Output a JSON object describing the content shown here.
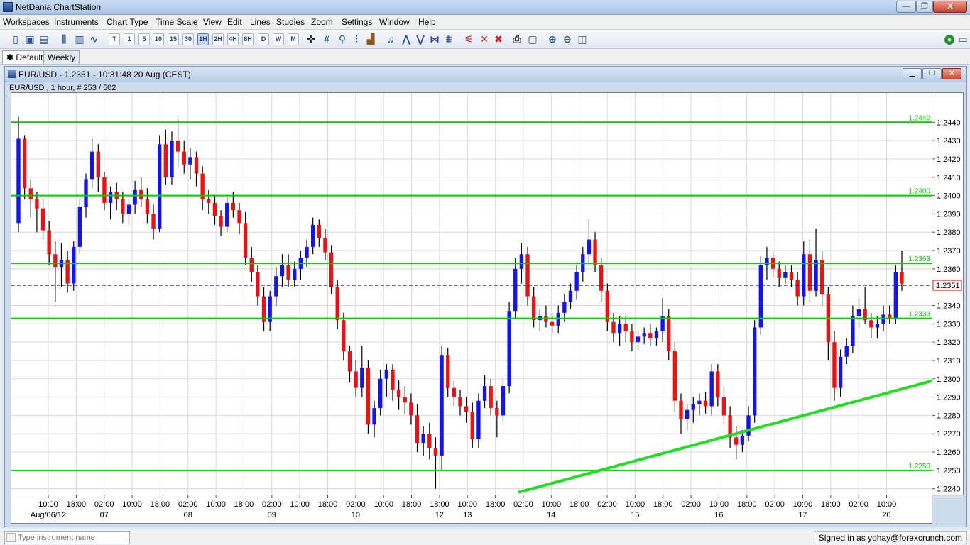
{
  "app": {
    "title": "NetDania ChartStation",
    "min_label": "—",
    "max_label": "❐",
    "close_label": "X"
  },
  "menu": [
    "Workspaces",
    "Instruments",
    "Chart Type",
    "Time Scale",
    "View",
    "Edit",
    "Lines",
    "Studies",
    "Zoom",
    "Settings",
    "Window",
    "Help"
  ],
  "toolbar": {
    "timescales": [
      "T",
      "1",
      "5",
      "10",
      "15",
      "30",
      "1H",
      "2H",
      "4H",
      "8H",
      "D",
      "W",
      "M"
    ],
    "active_timescale": "1H",
    "icons": [
      "new-icon",
      "save-icon",
      "print-setup-icon",
      "bar-chart-icon",
      "line-chart-icon",
      "crosshair-icon",
      "grid-icon",
      "candlestick-icon",
      "volume-icon",
      "alert-icon",
      "trendline-icon",
      "fibonacci-icon",
      "channel-icon",
      "parallel-icon",
      "delete-line-icon",
      "delete-all-icon",
      "print-icon",
      "print-preview-icon",
      "zoom-in-icon",
      "zoom-out-icon",
      "zoom-reset-icon",
      "connection-status-icon"
    ]
  },
  "tabs": [
    {
      "label": "Default",
      "active": true,
      "pin": "✱"
    },
    {
      "label": "Weekly",
      "active": false
    }
  ],
  "chart_window": {
    "title": "EUR/USD - 1.2351 - 10:31:48  20 Aug (CEST)",
    "subinfo": "EUR/USD , 1 hour, # 253 / 502"
  },
  "status": {
    "search_placeholder": "Type instrument name",
    "signed_in": "Signed in as yohay@forexcrunch.com"
  },
  "colors": {
    "up": "#1414e6",
    "down": "#e61414",
    "level_line": "#00cc00",
    "trend_line": "#22dd22",
    "grid": "#d8d8d8"
  },
  "chart_data": {
    "type": "candlestick",
    "symbol": "EUR/USD",
    "timeframe": "1 hour",
    "ylim": [
      1.2236,
      1.2456
    ],
    "last_price": "1.2351",
    "yticks": [
      "1.2440",
      "1.2430",
      "1.2420",
      "1.2410",
      "1.2400",
      "1.2390",
      "1.2380",
      "1.2370",
      "1.2360",
      "1.2350",
      "1.2340",
      "1.2330",
      "1.2320",
      "1.2310",
      "1.2300",
      "1.2290",
      "1.2280",
      "1.2270",
      "1.2260",
      "1.2250",
      "1.2240"
    ],
    "xticks": [
      "10:00",
      "18:00",
      "02:00",
      "10:00",
      "18:00",
      "02:00",
      "10:00",
      "18:00",
      "02:00",
      "10:00",
      "18:00",
      "02:00",
      "10:00",
      "18:00",
      "18:00",
      "10:00",
      "18:00",
      "02:00",
      "10:00",
      "18:00",
      "02:00",
      "10:00",
      "18:00",
      "02:00",
      "10:00",
      "18:00",
      "02:00",
      "10:00",
      "18:00",
      "02:00",
      "10:00"
    ],
    "date_labels": [
      "Aug/06/12",
      "07",
      "08",
      "09",
      "10",
      "12",
      "13",
      "14",
      "15",
      "16",
      "17",
      "20"
    ],
    "levels": [
      {
        "label": "1.2440",
        "value": 1.244
      },
      {
        "label": "1.2400",
        "value": 1.24
      },
      {
        "label": "1.2363",
        "value": 1.2363
      },
      {
        "label": "1.2333",
        "value": 1.2333
      },
      {
        "label": "1.2250",
        "value": 1.225
      }
    ],
    "trendline": {
      "from": {
        "bar": 0.55,
        "price": 1.2238
      },
      "to": {
        "bar": 1.0,
        "price": 1.2299
      }
    },
    "candles": [
      [
        1.2385,
        1.2443,
        1.238,
        1.2431
      ],
      [
        1.2431,
        1.2433,
        1.2398,
        1.2404
      ],
      [
        1.2404,
        1.2409,
        1.2388,
        1.2398
      ],
      [
        1.2398,
        1.2402,
        1.238,
        1.2393
      ],
      [
        1.2393,
        1.2398,
        1.2376,
        1.2381
      ],
      [
        1.2381,
        1.2386,
        1.2362,
        1.2368
      ],
      [
        1.2368,
        1.2375,
        1.2342,
        1.2361
      ],
      [
        1.2361,
        1.2374,
        1.235,
        1.2365
      ],
      [
        1.2365,
        1.237,
        1.2347,
        1.2352
      ],
      [
        1.2352,
        1.2375,
        1.2348,
        1.2372
      ],
      [
        1.2372,
        1.2398,
        1.2368,
        1.2394
      ],
      [
        1.2394,
        1.2412,
        1.2388,
        1.2409
      ],
      [
        1.2409,
        1.2431,
        1.2404,
        1.2424
      ],
      [
        1.2424,
        1.2428,
        1.2402,
        1.241
      ],
      [
        1.241,
        1.2413,
        1.2392,
        1.2396
      ],
      [
        1.2396,
        1.2405,
        1.2387,
        1.2402
      ],
      [
        1.2402,
        1.2407,
        1.2392,
        1.2398
      ],
      [
        1.2398,
        1.2402,
        1.2385,
        1.239
      ],
      [
        1.239,
        1.24,
        1.2384,
        1.2395
      ],
      [
        1.2395,
        1.2408,
        1.239,
        1.2403
      ],
      [
        1.2403,
        1.241,
        1.2394,
        1.2398
      ],
      [
        1.2398,
        1.2404,
        1.2385,
        1.239
      ],
      [
        1.239,
        1.2395,
        1.2376,
        1.2382
      ],
      [
        1.2382,
        1.2433,
        1.238,
        1.2428
      ],
      [
        1.2428,
        1.2436,
        1.2406,
        1.241
      ],
      [
        1.241,
        1.2435,
        1.2406,
        1.243
      ],
      [
        1.243,
        1.2442,
        1.2415,
        1.2424
      ],
      [
        1.2424,
        1.243,
        1.2412,
        1.2417
      ],
      [
        1.2417,
        1.2426,
        1.2409,
        1.2421
      ],
      [
        1.2421,
        1.2424,
        1.2405,
        1.2412
      ],
      [
        1.2412,
        1.2416,
        1.2392,
        1.2398
      ],
      [
        1.2398,
        1.2403,
        1.239,
        1.2396
      ],
      [
        1.2396,
        1.24,
        1.2384,
        1.2389
      ],
      [
        1.2389,
        1.2392,
        1.2378,
        1.2383
      ],
      [
        1.2383,
        1.2399,
        1.238,
        1.2396
      ],
      [
        1.2396,
        1.2402,
        1.2388,
        1.2392
      ],
      [
        1.2392,
        1.2396,
        1.2379,
        1.2385
      ],
      [
        1.2385,
        1.2391,
        1.2362,
        1.2366
      ],
      [
        1.2366,
        1.2372,
        1.2353,
        1.2358
      ],
      [
        1.2358,
        1.2362,
        1.234,
        1.2345
      ],
      [
        1.2345,
        1.235,
        1.2326,
        1.2331
      ],
      [
        1.2331,
        1.2348,
        1.2326,
        1.2345
      ],
      [
        1.2345,
        1.2361,
        1.234,
        1.2356
      ],
      [
        1.2356,
        1.2368,
        1.235,
        1.2362
      ],
      [
        1.2362,
        1.2368,
        1.235,
        1.2354
      ],
      [
        1.2354,
        1.2364,
        1.235,
        1.236
      ],
      [
        1.236,
        1.237,
        1.2354,
        1.2366
      ],
      [
        1.2366,
        1.2376,
        1.2361,
        1.2372
      ],
      [
        1.2372,
        1.2388,
        1.2368,
        1.2384
      ],
      [
        1.2384,
        1.2387,
        1.2372,
        1.2377
      ],
      [
        1.2377,
        1.2382,
        1.2365,
        1.2369
      ],
      [
        1.2369,
        1.2373,
        1.2346,
        1.235
      ],
      [
        1.235,
        1.2354,
        1.2327,
        1.2332
      ],
      [
        1.2332,
        1.2336,
        1.231,
        1.2315
      ],
      [
        1.2315,
        1.2318,
        1.2298,
        1.2304
      ],
      [
        1.2304,
        1.231,
        1.229,
        1.2295
      ],
      [
        1.2295,
        1.2318,
        1.229,
        1.2306
      ],
      [
        1.2306,
        1.231,
        1.227,
        1.2275
      ],
      [
        1.2275,
        1.2288,
        1.2268,
        1.2284
      ],
      [
        1.2284,
        1.2305,
        1.228,
        1.23
      ],
      [
        1.23,
        1.2308,
        1.229,
        1.2305
      ],
      [
        1.2305,
        1.2308,
        1.2288,
        1.2294
      ],
      [
        1.2294,
        1.2299,
        1.2283,
        1.229
      ],
      [
        1.229,
        1.2296,
        1.2281,
        1.2287
      ],
      [
        1.2287,
        1.2292,
        1.2275,
        1.228
      ],
      [
        1.228,
        1.2286,
        1.226,
        1.2265
      ],
      [
        1.2265,
        1.2274,
        1.2258,
        1.227
      ],
      [
        1.227,
        1.2276,
        1.2256,
        1.2262
      ],
      [
        1.2262,
        1.2268,
        1.224,
        1.2258
      ],
      [
        1.2258,
        1.2318,
        1.225,
        1.2313
      ],
      [
        1.2313,
        1.2317,
        1.229,
        1.2295
      ],
      [
        1.2295,
        1.2299,
        1.2285,
        1.229
      ],
      [
        1.229,
        1.2294,
        1.228,
        1.2285
      ],
      [
        1.2285,
        1.229,
        1.2276,
        1.2282
      ],
      [
        1.2282,
        1.2287,
        1.2262,
        1.2267
      ],
      [
        1.2267,
        1.2292,
        1.2262,
        1.2288
      ],
      [
        1.2288,
        1.2302,
        1.2284,
        1.2296
      ],
      [
        1.2296,
        1.23,
        1.228,
        1.2284
      ],
      [
        1.2284,
        1.2288,
        1.2268,
        1.228
      ],
      [
        1.228,
        1.23,
        1.2276,
        1.2296
      ],
      [
        1.2296,
        1.2342,
        1.2292,
        1.2337
      ],
      [
        1.2337,
        1.2366,
        1.2333,
        1.236
      ],
      [
        1.236,
        1.2374,
        1.2352,
        1.2368
      ],
      [
        1.2368,
        1.2372,
        1.234,
        1.2345
      ],
      [
        1.2345,
        1.235,
        1.2328,
        1.2332
      ],
      [
        1.2332,
        1.2338,
        1.2326,
        1.2334
      ],
      [
        1.2334,
        1.234,
        1.2328,
        1.2331
      ],
      [
        1.2331,
        1.2336,
        1.2325,
        1.2329
      ],
      [
        1.2329,
        1.234,
        1.2325,
        1.2336
      ],
      [
        1.2336,
        1.2346,
        1.2331,
        1.2342
      ],
      [
        1.2342,
        1.2352,
        1.2338,
        1.2348
      ],
      [
        1.2348,
        1.2362,
        1.2343,
        1.2358
      ],
      [
        1.2358,
        1.2372,
        1.2353,
        1.2368
      ],
      [
        1.2368,
        1.2387,
        1.2362,
        1.2376
      ],
      [
        1.2376,
        1.238,
        1.2358,
        1.2362
      ],
      [
        1.2362,
        1.2366,
        1.2342,
        1.2348
      ],
      [
        1.2348,
        1.2352,
        1.2326,
        1.2331
      ],
      [
        1.2331,
        1.2336,
        1.232,
        1.2325
      ],
      [
        1.2325,
        1.2334,
        1.2318,
        1.233
      ],
      [
        1.233,
        1.2334,
        1.232,
        1.2326
      ],
      [
        1.2326,
        1.233,
        1.2315,
        1.232
      ],
      [
        1.232,
        1.2326,
        1.2316,
        1.2323
      ],
      [
        1.2323,
        1.2328,
        1.2319,
        1.2325
      ],
      [
        1.2325,
        1.233,
        1.2318,
        1.2322
      ],
      [
        1.2322,
        1.2328,
        1.2318,
        1.2326
      ],
      [
        1.2326,
        1.2344,
        1.232,
        1.2334
      ],
      [
        1.2334,
        1.2338,
        1.231,
        1.2315
      ],
      [
        1.2315,
        1.232,
        1.2282,
        1.2288
      ],
      [
        1.2288,
        1.2292,
        1.227,
        1.2278
      ],
      [
        1.2278,
        1.2286,
        1.2272,
        1.2283
      ],
      [
        1.2283,
        1.229,
        1.2276,
        1.2286
      ],
      [
        1.2286,
        1.2292,
        1.228,
        1.2288
      ],
      [
        1.2288,
        1.2293,
        1.2281,
        1.2285
      ],
      [
        1.2285,
        1.2308,
        1.228,
        1.2304
      ],
      [
        1.2304,
        1.2308,
        1.2285,
        1.229
      ],
      [
        1.229,
        1.2296,
        1.2275,
        1.228
      ],
      [
        1.228,
        1.2285,
        1.2262,
        1.2268
      ],
      [
        1.2268,
        1.2274,
        1.2256,
        1.2264
      ],
      [
        1.2264,
        1.2272,
        1.226,
        1.2269
      ],
      [
        1.2269,
        1.2285,
        1.2266,
        1.228
      ],
      [
        1.228,
        1.2332,
        1.2276,
        1.2328
      ],
      [
        1.2328,
        1.2367,
        1.2324,
        1.2362
      ],
      [
        1.2362,
        1.2372,
        1.2354,
        1.2366
      ],
      [
        1.2366,
        1.237,
        1.2355,
        1.236
      ],
      [
        1.236,
        1.2364,
        1.235,
        1.2355
      ],
      [
        1.2355,
        1.2362,
        1.2352,
        1.2358
      ],
      [
        1.2358,
        1.2362,
        1.235,
        1.2354
      ],
      [
        1.2354,
        1.2358,
        1.234,
        1.2345
      ],
      [
        1.2345,
        1.2375,
        1.234,
        1.2368
      ],
      [
        1.2368,
        1.2376,
        1.2342,
        1.2348
      ],
      [
        1.2348,
        1.2382,
        1.2345,
        1.2365
      ],
      [
        1.2365,
        1.237,
        1.234,
        1.2346
      ],
      [
        1.2346,
        1.235,
        1.231,
        1.232
      ],
      [
        1.232,
        1.2326,
        1.2288,
        1.2295
      ],
      [
        1.2295,
        1.2316,
        1.229,
        1.2312
      ],
      [
        1.2312,
        1.2322,
        1.2308,
        1.2318
      ],
      [
        1.2318,
        1.234,
        1.2314,
        1.2334
      ],
      [
        1.2334,
        1.2344,
        1.2328,
        1.2338
      ],
      [
        1.2338,
        1.235,
        1.233,
        1.2332
      ],
      [
        1.2332,
        1.2336,
        1.2322,
        1.2328
      ],
      [
        1.2328,
        1.2334,
        1.2322,
        1.233
      ],
      [
        1.233,
        1.234,
        1.2326,
        1.2335
      ],
      [
        1.2335,
        1.234,
        1.233,
        1.2333
      ],
      [
        1.2333,
        1.2362,
        1.233,
        1.2358
      ],
      [
        1.2358,
        1.237,
        1.2348,
        1.2352
      ]
    ]
  }
}
